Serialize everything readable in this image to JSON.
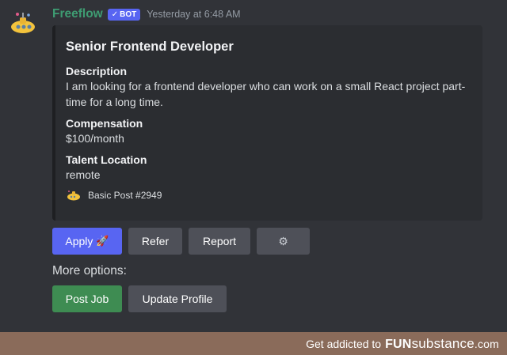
{
  "message": {
    "username": "Freeflow",
    "bot_tag": "BOT",
    "timestamp": "Yesterday at 6:48 AM"
  },
  "embed": {
    "title": "Senior Frontend Developer",
    "fields": [
      {
        "name": "Description",
        "value": "I am looking for a frontend developer who can work on a small React project part-time for a long time."
      },
      {
        "name": "Compensation",
        "value": "$100/month"
      },
      {
        "name": "Talent Location",
        "value": "remote"
      }
    ],
    "footer": "Basic Post #2949"
  },
  "buttons": {
    "apply": "Apply",
    "refer": "Refer",
    "report": "Report"
  },
  "more_options": {
    "label": "More options:",
    "post_job": "Post Job",
    "update_profile": "Update Profile"
  },
  "watermark": {
    "prefix": "Get addicted to",
    "brand_fun": "FUN",
    "brand_rest": "substance",
    "brand_suffix": ".com"
  },
  "colors": {
    "background": "#313338",
    "embed_bg": "#2b2d31",
    "primary": "#5865f2",
    "secondary": "#4e5058",
    "success": "#3e8c52"
  }
}
